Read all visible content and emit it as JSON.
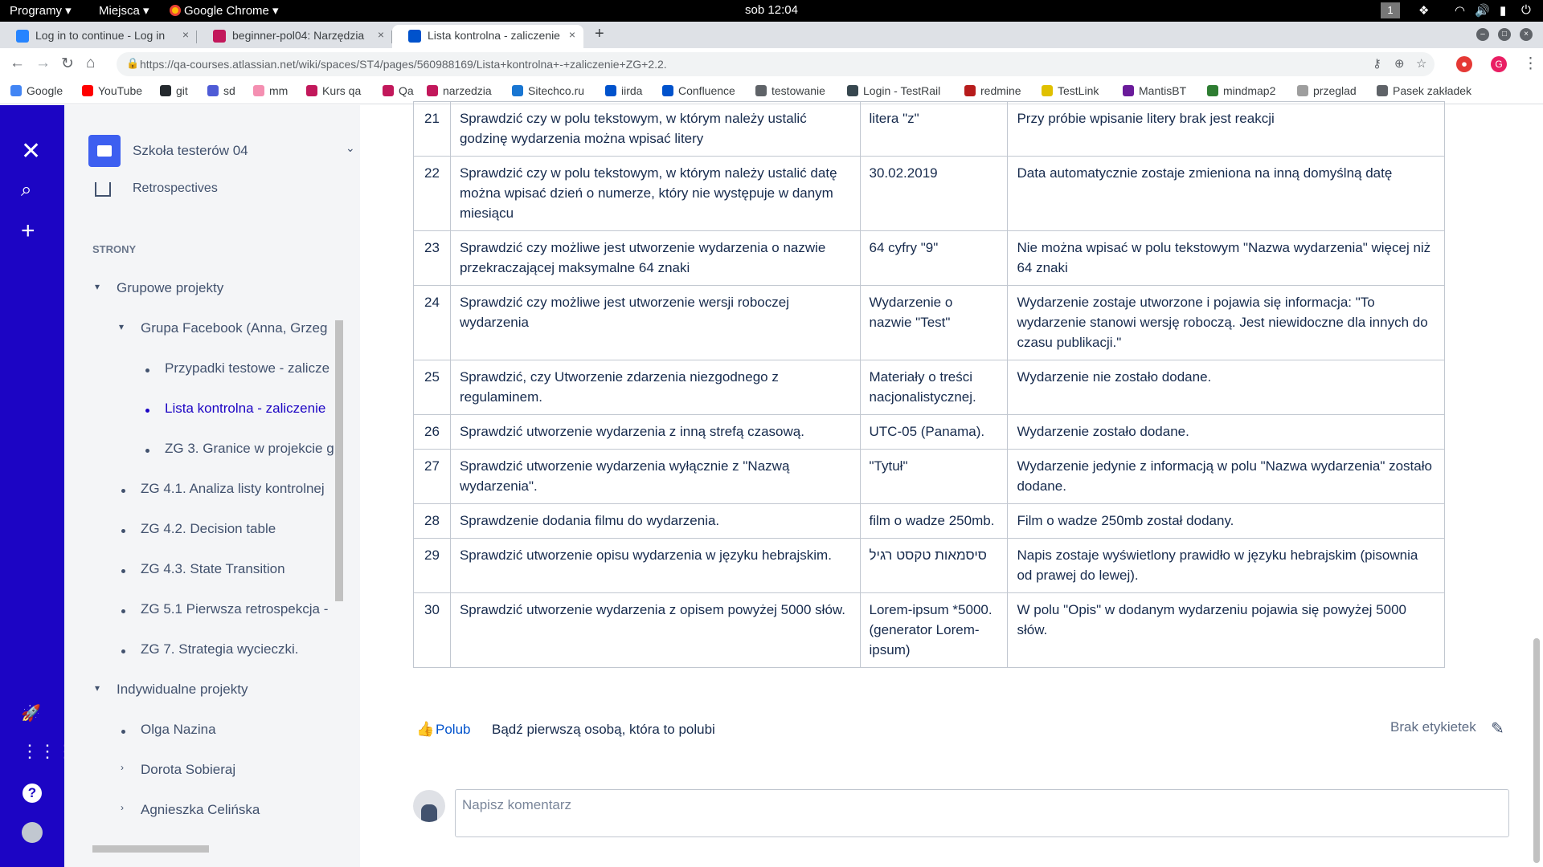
{
  "system": {
    "menu_apps": "Programy ▾",
    "menu_places": "Miejsca ▾",
    "menu_chrome": "Google Chrome ▾",
    "clock": "sob 12:04",
    "workspace": "1"
  },
  "tabs": [
    {
      "title": "Log in to continue - Log in",
      "close": "×"
    },
    {
      "title": "beginner-pol04: Narzędzia",
      "close": "×"
    },
    {
      "title": "Lista kontrolna - zaliczenie",
      "close": "×"
    }
  ],
  "new_tab": "+",
  "address": {
    "url": "https://qa-courses.atlassian.net/wiki/spaces/ST4/pages/560988169/Lista+kontrolna+-+zaliczenie+ZG+2.2."
  },
  "profile_initial": "G",
  "bookmarks": [
    {
      "label": "Google",
      "color": "#4285f4"
    },
    {
      "label": "YouTube",
      "color": "#ff0000"
    },
    {
      "label": "git",
      "color": "#24292e"
    },
    {
      "label": "sd",
      "color": "#4e5bd6"
    },
    {
      "label": "mm",
      "color": "#f48fb1"
    },
    {
      "label": "Kurs qa",
      "color": "#c2185b"
    },
    {
      "label": "Qa",
      "color": "#c2185b"
    },
    {
      "label": "narzedzia",
      "color": "#c2185b"
    },
    {
      "label": "Sitechco.ru",
      "color": "#1976d2"
    },
    {
      "label": "iirda",
      "color": "#0052cc"
    },
    {
      "label": "Confluence",
      "color": "#0052cc"
    },
    {
      "label": "testowanie",
      "color": "#5f6368"
    },
    {
      "label": "Login - TestRail",
      "color": "#37474f"
    },
    {
      "label": "redmine",
      "color": "#b71c1c"
    },
    {
      "label": "TestLink",
      "color": "#e0c000"
    },
    {
      "label": "MantisBT",
      "color": "#6a1b9a"
    },
    {
      "label": "mindmap2",
      "color": "#2e7d32"
    },
    {
      "label": "przeglad",
      "color": "#9e9e9e"
    },
    {
      "label": "Pasek zakładek",
      "color": "#5f6368"
    }
  ],
  "sidebar": {
    "space_name": "Szkoła testerów 04",
    "retro": "Retrospectives",
    "section": "STRONY",
    "items": [
      {
        "label": "Grupowe projekty"
      },
      {
        "label": "Grupa Facebook (Anna, Grzeg"
      },
      {
        "label": "Przypadki testowe - zalicze"
      },
      {
        "label": "Lista kontrolna - zaliczenie"
      },
      {
        "label": "ZG 3. Granice w projekcie g"
      },
      {
        "label": "ZG 4.1. Analiza listy kontrolnej"
      },
      {
        "label": "ZG 4.2. Decision table"
      },
      {
        "label": "ZG 4.3. State Transition"
      },
      {
        "label": "ZG 5.1 Pierwsza retrospekcja -"
      },
      {
        "label": "ZG 7. Strategia wycieczki."
      },
      {
        "label": "Indywidualne projekty"
      },
      {
        "label": "Olga Nazina"
      },
      {
        "label": "Dorota Sobieraj"
      },
      {
        "label": "Agnieszka Celińska"
      }
    ]
  },
  "table": {
    "rows": [
      {
        "n": "21",
        "desc": "Sprawdzić czy w polu tekstowym, w którym należy ustalić godzinę wydarzenia można wpisać litery",
        "value": "litera \"z\"",
        "result": "Przy próbie wpisanie litery brak jest reakcji"
      },
      {
        "n": "22",
        "desc": "Sprawdzić czy w polu tekstowym, w którym należy ustalić datę można wpisać dzień o numerze, który nie występuje w danym miesiącu",
        "value": "30.02.2019",
        "result": "Data automatycznie zostaje zmieniona na inną domyślną datę"
      },
      {
        "n": "23",
        "desc": "Sprawdzić czy możliwe jest utworzenie wydarzenia o nazwie przekraczającej maksymalne 64 znaki",
        "value": "64 cyfry \"9\"",
        "result": "Nie można wpisać w polu tekstowym \"Nazwa wydarzenia\" więcej niż 64 znaki"
      },
      {
        "n": "24",
        "desc": "Sprawdzić czy możliwe jest utworzenie wersji roboczej wydarzenia",
        "value": "Wydarzenie o nazwie \"Test\"",
        "result": "Wydarzenie zostaje utworzone i pojawia się informacja: \"To wydarzenie stanowi wersję roboczą. Jest niewidoczne dla innych do czasu publikacji.\""
      },
      {
        "n": "25",
        "desc": "Sprawdzić, czy Utworzenie zdarzenia niezgodnego z regulaminem.",
        "value": "Materiały o treści nacjonalistycznej.",
        "result": "Wydarzenie nie zostało dodane."
      },
      {
        "n": "26",
        "desc": "Sprawdzić utworzenie wydarzenia  z inną strefą czasową.",
        "value": "UTC-05 (Panama).",
        "result": "Wydarzenie zostało dodane."
      },
      {
        "n": "27",
        "desc": "Sprawdzić utworzenie wydarzenia wyłącznie z \"Nazwą wydarzenia\".",
        "value": "\"Tytuł\"",
        "result": "Wydarzenie jedynie z informacją w polu \"Nazwa wydarzenia\" zostało dodane."
      },
      {
        "n": "28",
        "desc": "Sprawdzenie dodania filmu do wydarzenia.",
        "value": "film o wadze 250mb.",
        "result": "Film o wadze 250mb został dodany."
      },
      {
        "n": "29",
        "desc": "Sprawdzić utworzenie opisu wydarzenia w języku hebrajskim.",
        "value": "סיסמאות טקסט רגיל",
        "result": " Napis zostaje wyświetlony prawidło w języku  hebrajskim (pisownia od prawej do lewej)."
      },
      {
        "n": "30",
        "desc": "Sprawdzić utworzenie wydarzenia z opisem powyżej 5000 słów.",
        "value": "Lorem-ipsum *5000. (generator Lorem-ipsum)",
        "result": "W polu \"Opis\"  w dodanym wydarzeniu pojawia się powyżej 5000 słów."
      }
    ]
  },
  "footer": {
    "like_label": "Polub",
    "like_first": "Bądź pierwszą osobą, która to polubi",
    "no_labels": "Brak etykietek",
    "comment_placeholder": "Napisz komentarz"
  },
  "colors": {
    "confluence_nav": "#1c05c4",
    "link": "#0052cc"
  }
}
